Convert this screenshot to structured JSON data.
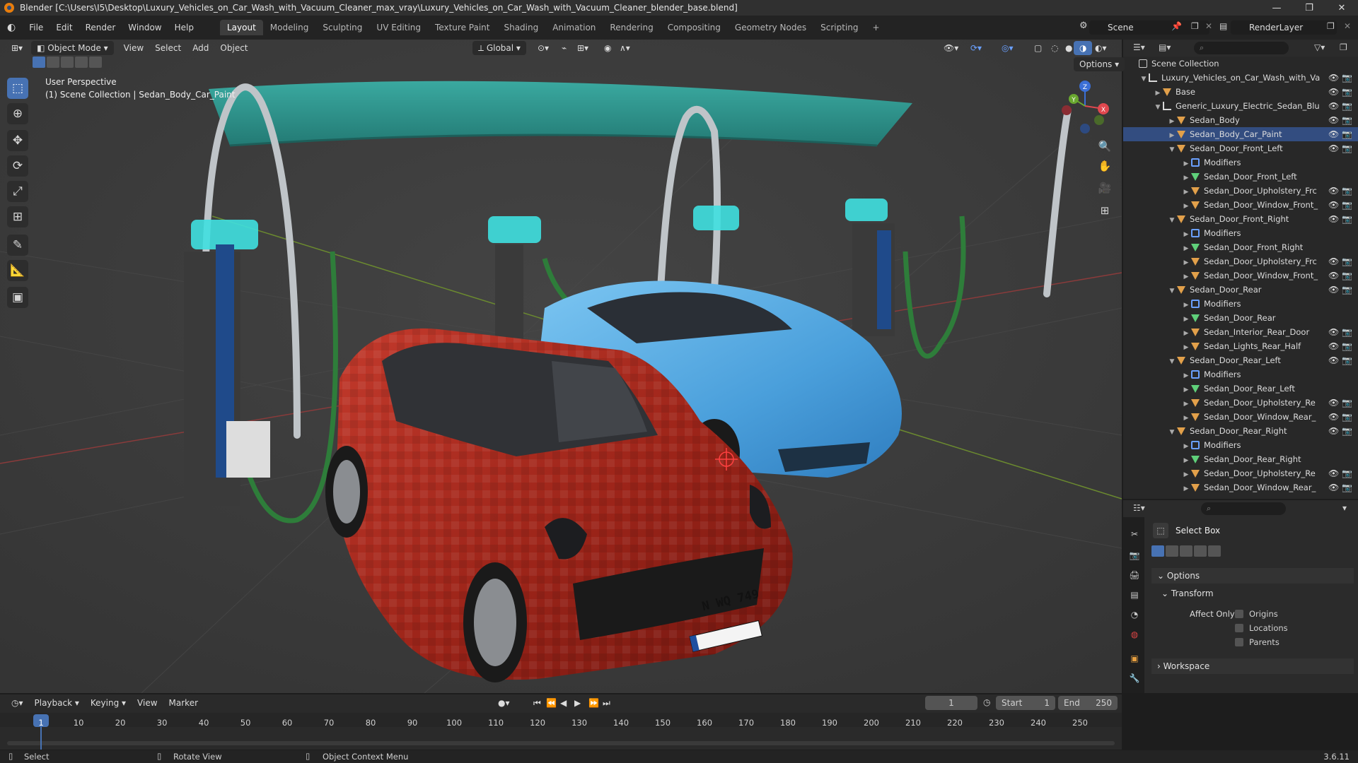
{
  "window": {
    "title": "Blender [C:\\Users\\I5\\Desktop\\Luxury_Vehicles_on_Car_Wash_with_Vacuum_Cleaner_max_vray\\Luxury_Vehicles_on_Car_Wash_with_Vacuum_Cleaner_blender_base.blend]",
    "min": "—",
    "max": "❐",
    "close": "✕"
  },
  "menu": [
    "File",
    "Edit",
    "Render",
    "Window",
    "Help"
  ],
  "workspaces": [
    "Layout",
    "Modeling",
    "Sculpting",
    "UV Editing",
    "Texture Paint",
    "Shading",
    "Animation",
    "Rendering",
    "Compositing",
    "Geometry Nodes",
    "Scripting"
  ],
  "workspace_add": "+",
  "scene": "Scene",
  "view_layer": "RenderLayer",
  "viewport": {
    "mode": "Object Mode",
    "menus": [
      "View",
      "Select",
      "Add",
      "Object"
    ],
    "orientation": "Global",
    "options": "Options",
    "perspective": "User Perspective",
    "context": "(1) Scene Collection | Sedan_Body_Car_Paint",
    "license_plate": "N WQ 749",
    "gizmo": {
      "x": "X",
      "y": "Y",
      "z": "Z"
    }
  },
  "tools": [
    "select-box",
    "cursor",
    "move",
    "rotate",
    "scale",
    "transform",
    "annotate",
    "measure",
    "add-cube"
  ],
  "outliner": {
    "root": "Scene Collection",
    "rows": [
      {
        "label": "Luxury_Vehicles_on_Car_Wash_with_Va",
        "type": "collection",
        "depth": 0,
        "expanded": true
      },
      {
        "label": "Base",
        "type": "mesh",
        "depth": 1,
        "expanded": false
      },
      {
        "label": "Generic_Luxury_Electric_Sedan_Blu",
        "type": "collection",
        "depth": 1,
        "expanded": true
      },
      {
        "label": "Sedan_Body",
        "type": "mesh",
        "depth": 2,
        "expanded": false
      },
      {
        "label": "Sedan_Body_Car_Paint",
        "type": "mesh",
        "depth": 2,
        "expanded": false
      },
      {
        "label": "Sedan_Door_Front_Left",
        "type": "mesh",
        "depth": 2,
        "expanded": true
      },
      {
        "label": "Modifiers",
        "type": "modifier",
        "depth": 3,
        "expanded": false
      },
      {
        "label": "Sedan_Door_Front_Left",
        "type": "data",
        "depth": 3,
        "expanded": false
      },
      {
        "label": "Sedan_Door_Upholstery_Frc",
        "type": "mesh",
        "depth": 3,
        "expanded": false
      },
      {
        "label": "Sedan_Door_Window_Front_",
        "type": "mesh",
        "depth": 3,
        "expanded": false
      },
      {
        "label": "Sedan_Door_Front_Right",
        "type": "mesh",
        "depth": 2,
        "expanded": true
      },
      {
        "label": "Modifiers",
        "type": "modifier",
        "depth": 3,
        "expanded": false
      },
      {
        "label": "Sedan_Door_Front_Right",
        "type": "data",
        "depth": 3,
        "expanded": false
      },
      {
        "label": "Sedan_Door_Upholstery_Frc",
        "type": "mesh",
        "depth": 3,
        "expanded": false
      },
      {
        "label": "Sedan_Door_Window_Front_",
        "type": "mesh",
        "depth": 3,
        "expanded": false
      },
      {
        "label": "Sedan_Door_Rear",
        "type": "mesh",
        "depth": 2,
        "expanded": true
      },
      {
        "label": "Modifiers",
        "type": "modifier",
        "depth": 3,
        "expanded": false
      },
      {
        "label": "Sedan_Door_Rear",
        "type": "data",
        "depth": 3,
        "expanded": false
      },
      {
        "label": "Sedan_Interior_Rear_Door",
        "type": "mesh",
        "depth": 3,
        "expanded": false
      },
      {
        "label": "Sedan_Lights_Rear_Half",
        "type": "mesh",
        "depth": 3,
        "expanded": false
      },
      {
        "label": "Sedan_Door_Rear_Left",
        "type": "mesh",
        "depth": 2,
        "expanded": true
      },
      {
        "label": "Modifiers",
        "type": "modifier",
        "depth": 3,
        "expanded": false
      },
      {
        "label": "Sedan_Door_Rear_Left",
        "type": "data",
        "depth": 3,
        "expanded": false
      },
      {
        "label": "Sedan_Door_Upholstery_Re",
        "type": "mesh",
        "depth": 3,
        "expanded": false
      },
      {
        "label": "Sedan_Door_Window_Rear_",
        "type": "mesh",
        "depth": 3,
        "expanded": false
      },
      {
        "label": "Sedan_Door_Rear_Right",
        "type": "mesh",
        "depth": 2,
        "expanded": true
      },
      {
        "label": "Modifiers",
        "type": "modifier",
        "depth": 3,
        "expanded": false
      },
      {
        "label": "Sedan_Door_Rear_Right",
        "type": "data",
        "depth": 3,
        "expanded": false
      },
      {
        "label": "Sedan_Door_Upholstery_Re",
        "type": "mesh",
        "depth": 3,
        "expanded": false
      },
      {
        "label": "Sedan_Door_Window_Rear_",
        "type": "mesh",
        "depth": 3,
        "expanded": false
      }
    ]
  },
  "properties": {
    "tool_name": "Select Box",
    "options_panel": "Options",
    "transform_panel": "Transform",
    "affect_only": "Affect Only",
    "checkboxes": [
      "Origins",
      "Locations",
      "Parents"
    ],
    "workspace_panel": "Workspace"
  },
  "timeline": {
    "menus": [
      "Playback",
      "Keying",
      "View",
      "Marker"
    ],
    "current_frame": "1",
    "start_label": "Start",
    "start": "1",
    "end_label": "End",
    "end": "250",
    "ruler": [
      1,
      10,
      20,
      30,
      40,
      50,
      60,
      70,
      80,
      90,
      100,
      110,
      120,
      130,
      140,
      150,
      160,
      170,
      180,
      190,
      200,
      210,
      220,
      230,
      240,
      250
    ]
  },
  "status": {
    "left": "Select",
    "middle": "Rotate View",
    "right": "Object Context Menu",
    "version": "3.6.11"
  },
  "colors": {
    "accent": "#4772b3",
    "red_car": "#a3261d",
    "blue_car": "#56a8e0",
    "canopy": "#2f9a92",
    "mesh_icon": "#e2a04a",
    "collection_icon": "#d8d8d8"
  }
}
